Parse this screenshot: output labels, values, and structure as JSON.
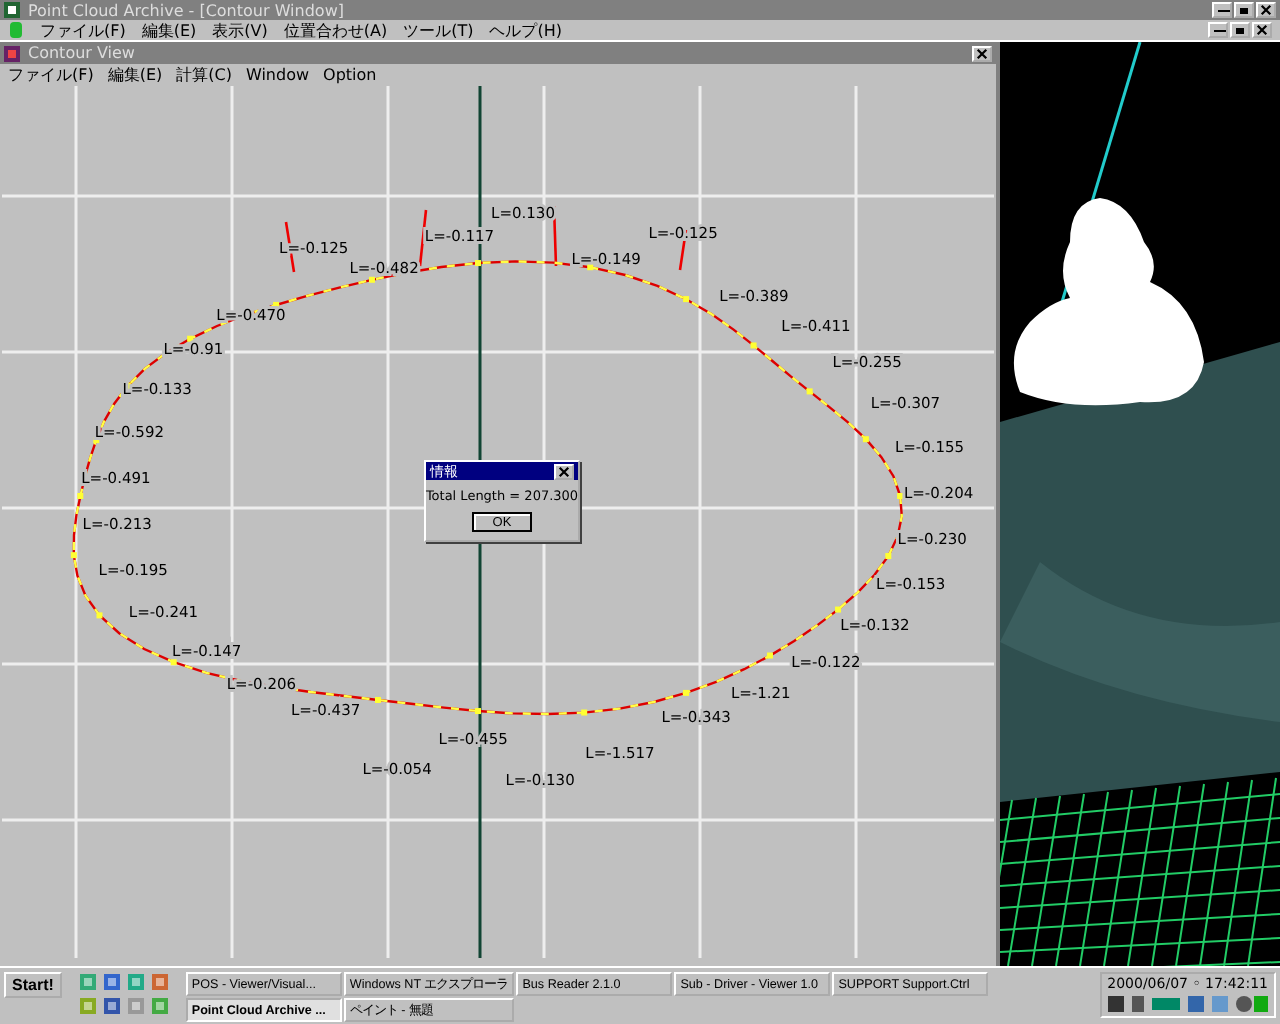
{
  "window": {
    "title": "Point Cloud Archive - [Contour Window]"
  },
  "menu": [
    "ファイル(F)",
    "編集(E)",
    "表示(V)",
    "位置合わせ(A)",
    "ツール(T)",
    "ヘルプ(H)"
  ],
  "contour_window": {
    "title": "Contour View",
    "menu": [
      "ファイル(F)",
      "編集(E)",
      "計算(C)",
      "Window",
      "Option"
    ],
    "labels": [
      "L=0.130",
      "L=-0.125",
      "L=-0.125",
      "L=-0.117",
      "L=-0.149",
      "L=-0.482",
      "L=-0.470",
      "L=-0.389",
      "L=-0.411",
      "L=-0.91",
      "L=-0.255",
      "L=-0.133",
      "L=-0.307",
      "L=-0.592",
      "L=-0.155",
      "L=-0.491",
      "L=-0.204",
      "L=-0.213",
      "L=-0.230",
      "L=-0.195",
      "L=-0.153",
      "L=-0.241",
      "L=-0.132",
      "L=-0.147",
      "L=-0.122",
      "L=-0.206",
      "L=-0.437",
      "L=-1.21",
      "L=-0.343",
      "L=-0.455",
      "L=-1.517",
      "L=-0.054",
      "L=-0.130"
    ]
  },
  "dialog": {
    "title": "情報",
    "message": "Total Length = 207.300",
    "button": "OK"
  },
  "taskbar": {
    "start": "Start!",
    "tasks": [
      {
        "label": "POS - Viewer/Visual...",
        "selected": false
      },
      {
        "label": "Windows NT エクスプローラ",
        "selected": false
      },
      {
        "label": "Bus Reader 2.1.0",
        "selected": false
      },
      {
        "label": "Sub - Driver - Viewer 1.0",
        "selected": false
      },
      {
        "label": "SUPPORT Support.Ctrl",
        "selected": false
      },
      {
        "label": "Point Cloud Archive ...",
        "selected": true
      },
      {
        "label": "ペイント - 無題",
        "selected": false
      }
    ],
    "clock": "2000/06/07 ◦ 17:42:11"
  }
}
